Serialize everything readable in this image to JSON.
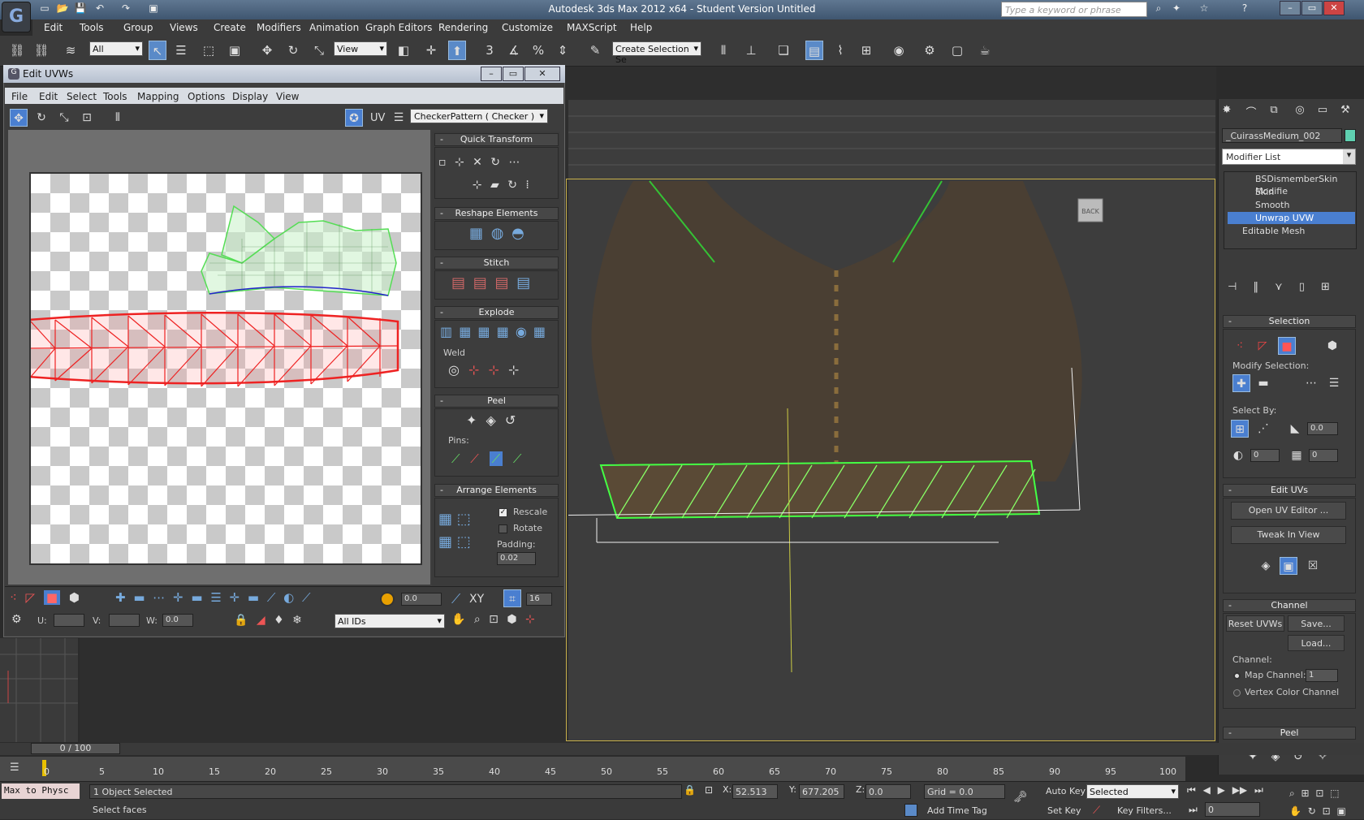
{
  "app": {
    "title": "Autodesk 3ds Max  2012 x64  - Student Version   Untitled",
    "search_placeholder": "Type a keyword or phrase"
  },
  "menu": [
    "Edit",
    "Tools",
    "Group",
    "Views",
    "Create",
    "Modifiers",
    "Animation",
    "Graph Editors",
    "Rendering",
    "Customize",
    "MAXScript",
    "Help"
  ],
  "toolbar": {
    "filter": "All",
    "refcoord": "View",
    "named_selection": "Create Selection Se",
    "snap_label": "3"
  },
  "uv_editor": {
    "title": "Edit UVWs",
    "menu": [
      "File",
      "Edit",
      "Select",
      "Tools",
      "Mapping",
      "Options",
      "Display",
      "View"
    ],
    "uv_label": "UV",
    "checker": "CheckerPattern  ( Checker )",
    "rollouts": {
      "quick_transform": "Quick Transform",
      "reshape": "Reshape Elements",
      "stitch": "Stitch",
      "explode": "Explode",
      "weld": "Weld",
      "peel": "Peel",
      "pins": "Pins:",
      "arrange": "Arrange Elements",
      "rescale": "Rescale",
      "rotate": "Rotate",
      "padding": "Padding:",
      "padding_value": "0.02"
    },
    "bottom": {
      "spin_value": "0.0",
      "xy": "XY",
      "grid_value": "16",
      "u_label": "U:",
      "v_label": "V:",
      "w_label": "W:",
      "w_value": "0.0",
      "ids": "All IDs"
    }
  },
  "right_panel": {
    "object_name": "_CuirassMedium_002",
    "modifier_list": "Modifier List",
    "stack": [
      {
        "label": "BSDismemberSkin Modifie",
        "selected": false
      },
      {
        "label": "Skin",
        "selected": false
      },
      {
        "label": "Smooth",
        "selected": false
      },
      {
        "label": "Unwrap UVW",
        "selected": true
      },
      {
        "label": "Editable Mesh",
        "selected": false
      }
    ],
    "selection": {
      "header": "Selection",
      "modify_selection": "Modify Selection:",
      "select_by": "Select By:",
      "val1": "0.0",
      "val2": "0",
      "val3": "0"
    },
    "edit_uvs": {
      "header": "Edit UVs",
      "open": "Open UV Editor ...",
      "tweak": "Tweak In View"
    },
    "channel": {
      "header": "Channel",
      "reset": "Reset UVWs",
      "save": "Save...",
      "load": "Load...",
      "channel_label": "Channel:",
      "map_channel": "Map Channel:",
      "map_value": "1",
      "vertex_color": "Vertex Color Channel"
    },
    "peel": {
      "header": "Peel"
    }
  },
  "viewport": {
    "back_label": "BACK"
  },
  "timeline": {
    "frame": "0 / 100",
    "ticks": [
      "0",
      "5",
      "10",
      "15",
      "20",
      "25",
      "30",
      "35",
      "40",
      "45",
      "50",
      "55",
      "60",
      "65",
      "70",
      "75",
      "80",
      "85",
      "90",
      "95",
      "100"
    ]
  },
  "status": {
    "listener": "Max to Physc",
    "selected": "1 Object Selected",
    "prompt": "Select faces",
    "x_label": "X:",
    "x": "52.513",
    "y_label": "Y:",
    "y": "677.205",
    "z_label": "Z:",
    "z": "0.0",
    "grid": "Grid = 0.0",
    "add_time_tag": "Add Time Tag",
    "auto_key": "Auto Key",
    "selected_dd": "Selected",
    "set_key": "Set Key",
    "key_filters": "Key Filters...",
    "frame_value": "0"
  }
}
